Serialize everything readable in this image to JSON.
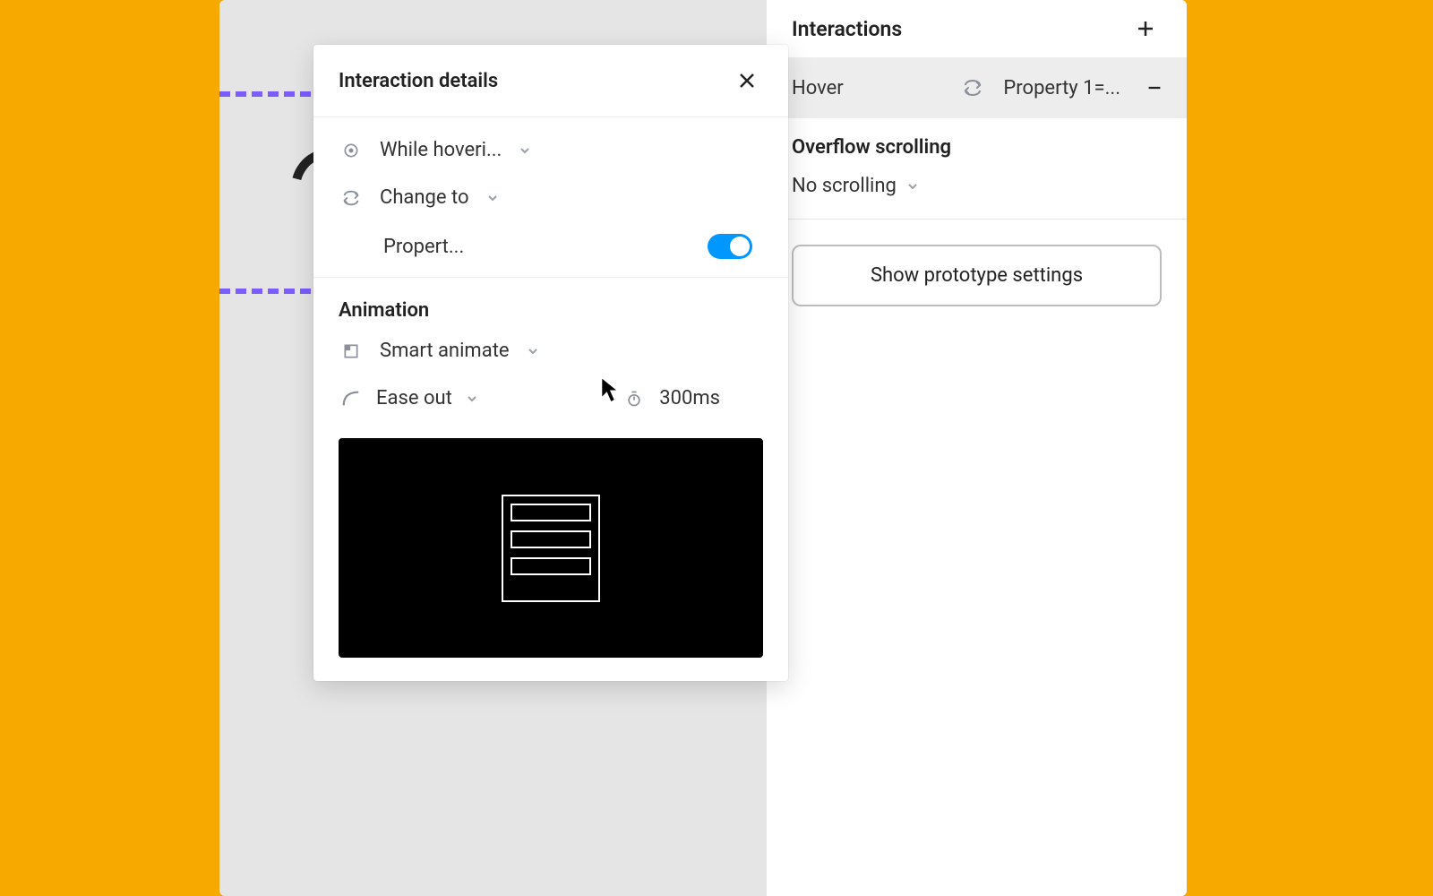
{
  "sidebar": {
    "interactions_title": "Interactions",
    "row": {
      "trigger": "Hover",
      "dest": "Property 1=..."
    },
    "overflow_title": "Overflow scrolling",
    "overflow_value": "No scrolling",
    "prototype_btn": "Show prototype settings"
  },
  "popover": {
    "title": "Interaction details",
    "trigger": "While hoveri...",
    "action": "Change to",
    "property_label": "Propert...",
    "property_on": true,
    "animation_title": "Animation",
    "transition": "Smart animate",
    "easing": "Ease out",
    "duration": "300ms"
  }
}
